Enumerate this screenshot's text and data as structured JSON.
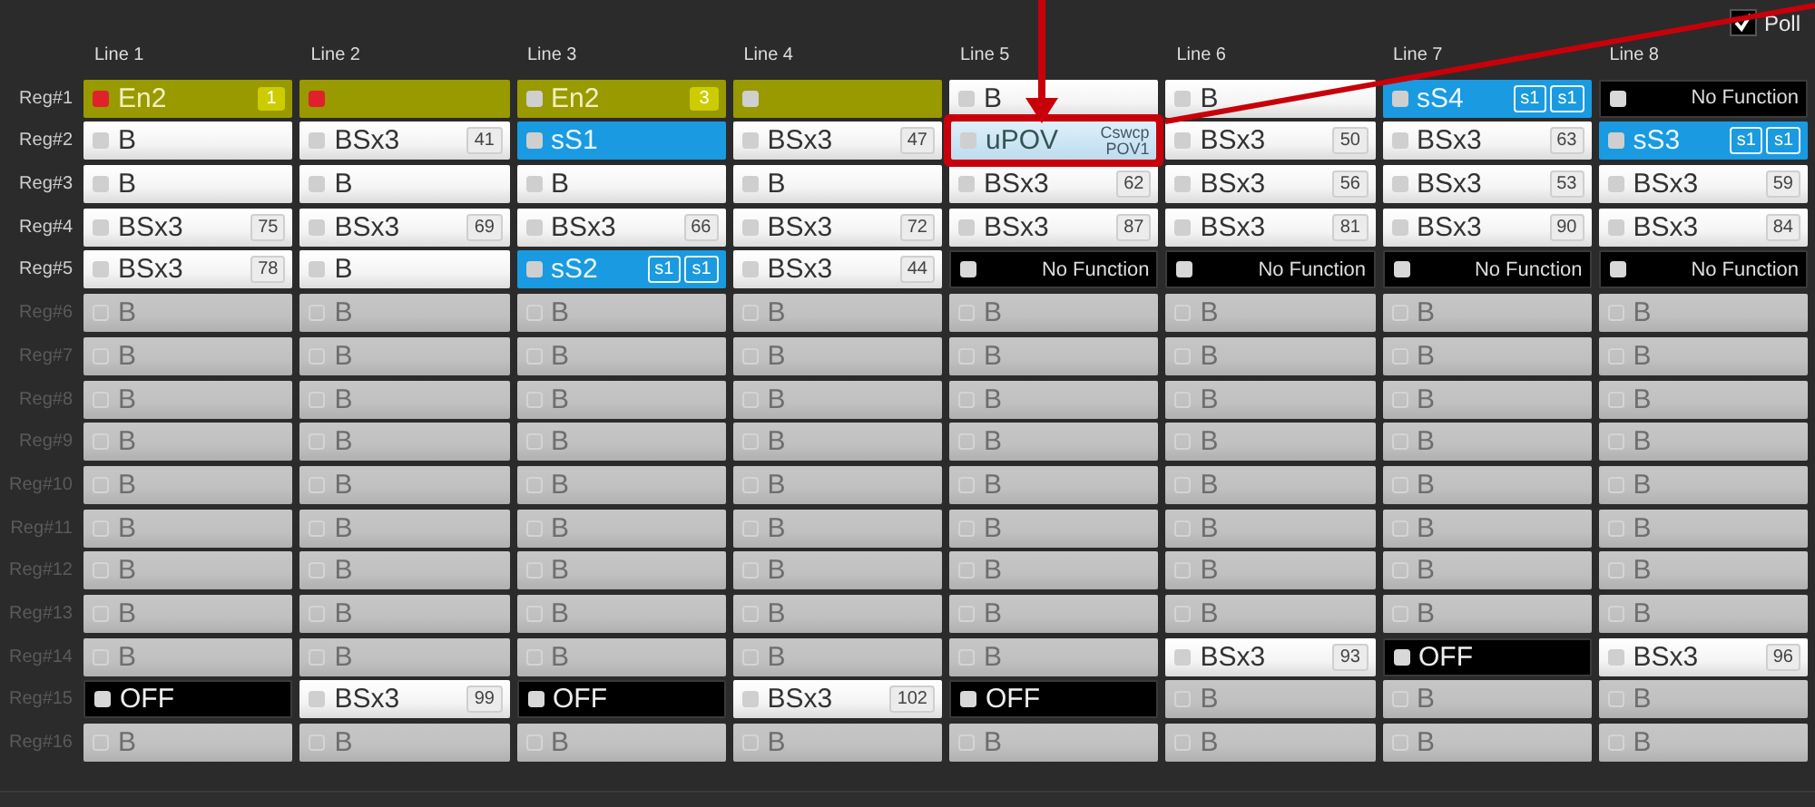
{
  "poll": {
    "label": "Poll",
    "checked": true
  },
  "columns": [
    "Line 1",
    "Line 2",
    "Line 3",
    "Line 4",
    "Line 5",
    "Line 6",
    "Line 7",
    "Line 8"
  ],
  "rows": [
    {
      "label": "Reg#1",
      "active": true,
      "cells": [
        {
          "kind": "enabled",
          "text": "En2",
          "badges": [
            "1"
          ],
          "lit": true
        },
        {
          "kind": "enabled",
          "lit": true
        },
        {
          "kind": "enabled",
          "text": "En2",
          "badges": [
            "3"
          ],
          "lit": false
        },
        {
          "kind": "enabled",
          "lit": false
        },
        {
          "kind": "white",
          "text": "B"
        },
        {
          "kind": "white",
          "text": "B"
        },
        {
          "kind": "blue",
          "text": "sS4",
          "badges": [
            "s1",
            "s1"
          ]
        },
        {
          "kind": "none",
          "text": "No Function"
        }
      ]
    },
    {
      "label": "Reg#2",
      "active": true,
      "cells": [
        {
          "kind": "white",
          "text": "B"
        },
        {
          "kind": "white",
          "text": "BSx3",
          "badges": [
            "41"
          ]
        },
        {
          "kind": "blue",
          "text": "sS1"
        },
        {
          "kind": "white",
          "text": "BSx3",
          "badges": [
            "47"
          ]
        },
        {
          "kind": "pale",
          "text": "uPOV",
          "sub": [
            "Cswcp",
            "POV1"
          ],
          "highlighted": true
        },
        {
          "kind": "white",
          "text": "BSx3",
          "badges": [
            "50"
          ]
        },
        {
          "kind": "white",
          "text": "BSx3",
          "badges": [
            "63"
          ]
        },
        {
          "kind": "blue",
          "text": "sS3",
          "badges": [
            "s1",
            "s1"
          ]
        }
      ]
    },
    {
      "label": "Reg#3",
      "active": true,
      "cells": [
        {
          "kind": "white",
          "text": "B"
        },
        {
          "kind": "white",
          "text": "B"
        },
        {
          "kind": "white",
          "text": "B"
        },
        {
          "kind": "white",
          "text": "B"
        },
        {
          "kind": "white",
          "text": "BSx3",
          "badges": [
            "62"
          ]
        },
        {
          "kind": "white",
          "text": "BSx3",
          "badges": [
            "56"
          ]
        },
        {
          "kind": "white",
          "text": "BSx3",
          "badges": [
            "53"
          ]
        },
        {
          "kind": "white",
          "text": "BSx3",
          "badges": [
            "59"
          ]
        }
      ]
    },
    {
      "label": "Reg#4",
      "active": true,
      "cells": [
        {
          "kind": "white",
          "text": "BSx3",
          "badges": [
            "75"
          ]
        },
        {
          "kind": "white",
          "text": "BSx3",
          "badges": [
            "69"
          ]
        },
        {
          "kind": "white",
          "text": "BSx3",
          "badges": [
            "66"
          ]
        },
        {
          "kind": "white",
          "text": "BSx3",
          "badges": [
            "72"
          ]
        },
        {
          "kind": "white",
          "text": "BSx3",
          "badges": [
            "87"
          ]
        },
        {
          "kind": "white",
          "text": "BSx3",
          "badges": [
            "81"
          ]
        },
        {
          "kind": "white",
          "text": "BSx3",
          "badges": [
            "90"
          ]
        },
        {
          "kind": "white",
          "text": "BSx3",
          "badges": [
            "84"
          ]
        }
      ]
    },
    {
      "label": "Reg#5",
      "active": true,
      "cells": [
        {
          "kind": "white",
          "text": "BSx3",
          "badges": [
            "78"
          ]
        },
        {
          "kind": "white",
          "text": "B"
        },
        {
          "kind": "blue",
          "text": "sS2",
          "badges": [
            "s1",
            "s1"
          ]
        },
        {
          "kind": "white",
          "text": "BSx3",
          "badges": [
            "44"
          ]
        },
        {
          "kind": "none",
          "text": "No Function"
        },
        {
          "kind": "none",
          "text": "No Function"
        },
        {
          "kind": "none",
          "text": "No Function"
        },
        {
          "kind": "none",
          "text": "No Function"
        }
      ]
    },
    {
      "label": "Reg#6",
      "active": false,
      "cells": [
        {
          "kind": "grey",
          "text": "B"
        },
        {
          "kind": "grey",
          "text": "B"
        },
        {
          "kind": "grey",
          "text": "B"
        },
        {
          "kind": "grey",
          "text": "B"
        },
        {
          "kind": "grey",
          "text": "B"
        },
        {
          "kind": "grey",
          "text": "B"
        },
        {
          "kind": "grey",
          "text": "B"
        },
        {
          "kind": "grey",
          "text": "B"
        }
      ]
    },
    {
      "label": "Reg#7",
      "active": false,
      "cells": [
        {
          "kind": "grey",
          "text": "B"
        },
        {
          "kind": "grey",
          "text": "B"
        },
        {
          "kind": "grey",
          "text": "B"
        },
        {
          "kind": "grey",
          "text": "B"
        },
        {
          "kind": "grey",
          "text": "B"
        },
        {
          "kind": "grey",
          "text": "B"
        },
        {
          "kind": "grey",
          "text": "B"
        },
        {
          "kind": "grey",
          "text": "B"
        }
      ]
    },
    {
      "label": "Reg#8",
      "active": false,
      "cells": [
        {
          "kind": "grey",
          "text": "B"
        },
        {
          "kind": "grey",
          "text": "B"
        },
        {
          "kind": "grey",
          "text": "B"
        },
        {
          "kind": "grey",
          "text": "B"
        },
        {
          "kind": "grey",
          "text": "B"
        },
        {
          "kind": "grey",
          "text": "B"
        },
        {
          "kind": "grey",
          "text": "B"
        },
        {
          "kind": "grey",
          "text": "B"
        }
      ]
    },
    {
      "label": "Reg#9",
      "active": false,
      "cells": [
        {
          "kind": "grey",
          "text": "B"
        },
        {
          "kind": "grey",
          "text": "B"
        },
        {
          "kind": "grey",
          "text": "B"
        },
        {
          "kind": "grey",
          "text": "B"
        },
        {
          "kind": "grey",
          "text": "B"
        },
        {
          "kind": "grey",
          "text": "B"
        },
        {
          "kind": "grey",
          "text": "B"
        },
        {
          "kind": "grey",
          "text": "B"
        }
      ]
    },
    {
      "label": "Reg#10",
      "active": false,
      "cells": [
        {
          "kind": "grey",
          "text": "B"
        },
        {
          "kind": "grey",
          "text": "B"
        },
        {
          "kind": "grey",
          "text": "B"
        },
        {
          "kind": "grey",
          "text": "B"
        },
        {
          "kind": "grey",
          "text": "B"
        },
        {
          "kind": "grey",
          "text": "B"
        },
        {
          "kind": "grey",
          "text": "B"
        },
        {
          "kind": "grey",
          "text": "B"
        }
      ]
    },
    {
      "label": "Reg#11",
      "active": false,
      "cells": [
        {
          "kind": "grey",
          "text": "B"
        },
        {
          "kind": "grey",
          "text": "B"
        },
        {
          "kind": "grey",
          "text": "B"
        },
        {
          "kind": "grey",
          "text": "B"
        },
        {
          "kind": "grey",
          "text": "B"
        },
        {
          "kind": "grey",
          "text": "B"
        },
        {
          "kind": "grey",
          "text": "B"
        },
        {
          "kind": "grey",
          "text": "B"
        }
      ]
    },
    {
      "label": "Reg#12",
      "active": false,
      "cells": [
        {
          "kind": "grey",
          "text": "B"
        },
        {
          "kind": "grey",
          "text": "B"
        },
        {
          "kind": "grey",
          "text": "B"
        },
        {
          "kind": "grey",
          "text": "B"
        },
        {
          "kind": "grey",
          "text": "B"
        },
        {
          "kind": "grey",
          "text": "B"
        },
        {
          "kind": "grey",
          "text": "B"
        },
        {
          "kind": "grey",
          "text": "B"
        }
      ]
    },
    {
      "label": "Reg#13",
      "active": false,
      "cells": [
        {
          "kind": "grey",
          "text": "B"
        },
        {
          "kind": "grey",
          "text": "B"
        },
        {
          "kind": "grey",
          "text": "B"
        },
        {
          "kind": "grey",
          "text": "B"
        },
        {
          "kind": "grey",
          "text": "B"
        },
        {
          "kind": "grey",
          "text": "B"
        },
        {
          "kind": "grey",
          "text": "B"
        },
        {
          "kind": "grey",
          "text": "B"
        }
      ]
    },
    {
      "label": "Reg#14",
      "active": false,
      "cells": [
        {
          "kind": "grey",
          "text": "B"
        },
        {
          "kind": "grey",
          "text": "B"
        },
        {
          "kind": "grey",
          "text": "B"
        },
        {
          "kind": "grey",
          "text": "B"
        },
        {
          "kind": "grey",
          "text": "B"
        },
        {
          "kind": "white",
          "text": "BSx3",
          "badges": [
            "93"
          ]
        },
        {
          "kind": "off",
          "text": "OFF"
        },
        {
          "kind": "white",
          "text": "BSx3",
          "badges": [
            "96"
          ]
        }
      ]
    },
    {
      "label": "Reg#15",
      "active": false,
      "cells": [
        {
          "kind": "off",
          "text": "OFF"
        },
        {
          "kind": "white",
          "text": "BSx3",
          "badges": [
            "99"
          ]
        },
        {
          "kind": "off",
          "text": "OFF"
        },
        {
          "kind": "white",
          "text": "BSx3",
          "badges": [
            "102"
          ]
        },
        {
          "kind": "off",
          "text": "OFF"
        },
        {
          "kind": "grey",
          "text": "B"
        },
        {
          "kind": "grey",
          "text": "B"
        },
        {
          "kind": "grey",
          "text": "B"
        }
      ]
    },
    {
      "label": "Reg#16",
      "active": false,
      "cells": [
        {
          "kind": "grey",
          "text": "B"
        },
        {
          "kind": "grey",
          "text": "B"
        },
        {
          "kind": "grey",
          "text": "B"
        },
        {
          "kind": "grey",
          "text": "B"
        },
        {
          "kind": "grey",
          "text": "B"
        },
        {
          "kind": "grey",
          "text": "B"
        },
        {
          "kind": "grey",
          "text": "B"
        },
        {
          "kind": "grey",
          "text": "B"
        }
      ]
    }
  ]
}
